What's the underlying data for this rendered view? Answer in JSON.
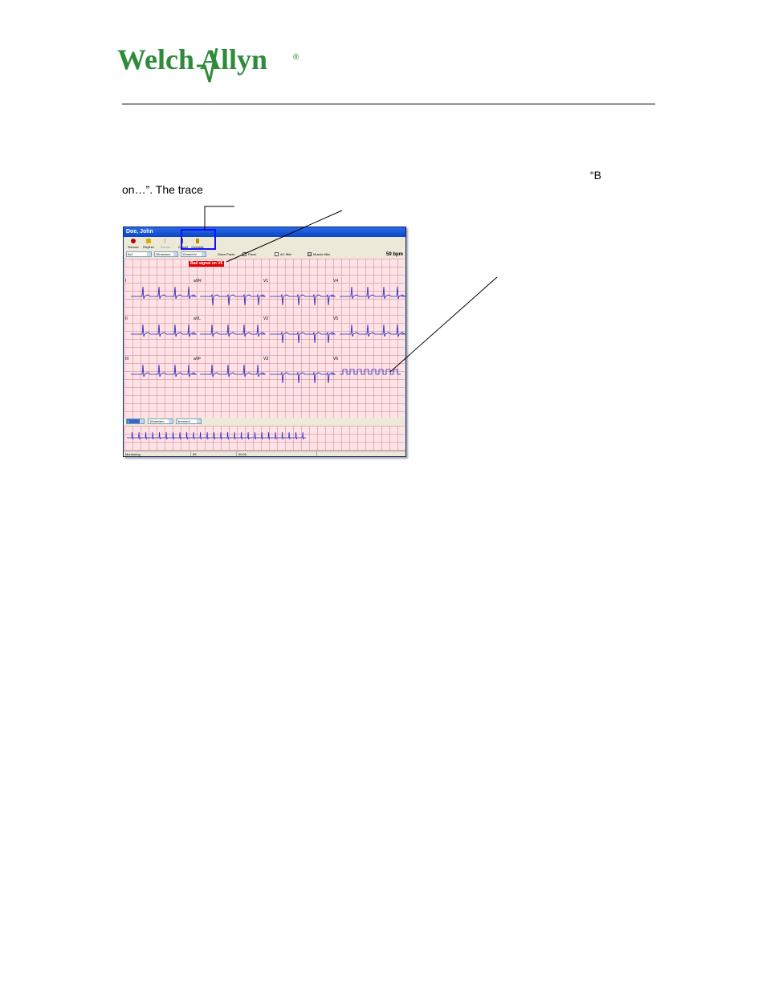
{
  "brand": {
    "name": "Welch Allyn",
    "registered": "®",
    "color": "#2e8b3a"
  },
  "document": {
    "text_line_1_end": "“B",
    "text_line_2": "on…”.  The trace"
  },
  "app": {
    "window_title": "Doe, John",
    "toolbar": {
      "record": "Record",
      "rhythm": "Rhythm",
      "events": "Events",
      "cancel": "Cancel",
      "override": "Override"
    },
    "controls": {
      "lead_group": "6x2",
      "speed": "25mm/sec",
      "gain": "10mm/mV",
      "show_pacer": "Show Pacer",
      "pacer_label": "Pacer",
      "ac_filter": "AC filter",
      "muscle_filter": "Muscle filter",
      "muscle_filter_check": "☑"
    },
    "heart_rate": "59 bpm",
    "alert": "Bad signal on V6",
    "leads": [
      "I",
      "aVR",
      "V1",
      "V4",
      "II",
      "aVL",
      "V2",
      "V5",
      "III",
      "aVF",
      "V3",
      "V6"
    ],
    "rhythm_controls": {
      "lead": "II",
      "speed": "10mm/sec",
      "gain": "5mm/mV"
    },
    "status": {
      "mode": "Monitoring",
      "rate": "59",
      "time": "00:00"
    },
    "colors": {
      "trace": "#2020c0",
      "grid_bg": "#fbe3e6",
      "alert_bg": "#e00000",
      "highlight": "#1010ff"
    }
  }
}
